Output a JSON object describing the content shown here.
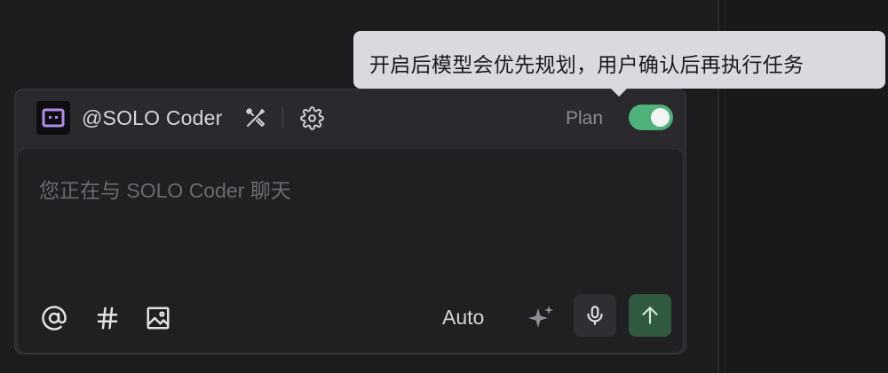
{
  "composer": {
    "agent_name": "@SOLO Coder",
    "plan_label": "Plan",
    "plan_enabled": true,
    "placeholder": "您正在与 SOLO Coder 聊天",
    "mode_label": "Auto",
    "icons": {
      "avatar": "robot-face-icon",
      "tools": "tools-icon",
      "settings": "gear-icon",
      "mention": "at-icon",
      "hashtag": "hash-icon",
      "image": "image-icon",
      "enhance": "sparkle-icon",
      "voice": "microphone-icon",
      "send": "arrow-up-icon"
    }
  },
  "tooltip": {
    "text": "开启后模型会优先规划，用户确认后再执行任务"
  },
  "colors": {
    "background": "#1c1c1f",
    "toggle_on": "#4fb27a",
    "send_button": "#2f5a3d",
    "tooltip_bg": "#d9dadf"
  }
}
